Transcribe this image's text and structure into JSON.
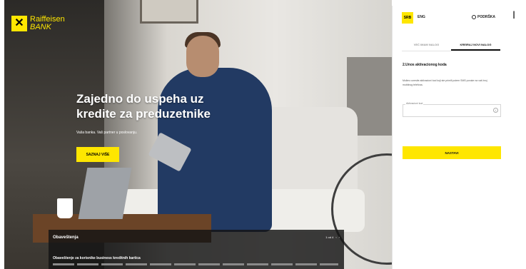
{
  "brand": {
    "logo_line1": "Raiffeisen",
    "logo_line2": "BANK",
    "accent": "#fee600"
  },
  "hero": {
    "title": "Zajedno do uspeha uz kredite za preduzetnike",
    "subtitle": "Vaša banka. Vaš partner u poslovanju.",
    "cta": "SAZNAJ VIŠE"
  },
  "news": {
    "label": "Obaveštenja",
    "pager": "1 od 4",
    "headline": "Obaveštenje za korisnike business kreditnih kartica"
  },
  "panel": {
    "lang_active": "SRB",
    "lang_other": "ENG",
    "support": "PODRŠKA",
    "tabs": [
      "VEĆ IMAM NALOG",
      "KREIRAJ NOVI NALOG"
    ],
    "step_title": "2.Unos aktivacionog koda",
    "step_desc": "Molimo unesite aktivacioni kod koji ste primili putem SMS poruke na vaš broj mobilnog telefona.",
    "code_placeholder": "Aktivacioni kod",
    "continue": "NASTAVI"
  },
  "cursor": "I"
}
